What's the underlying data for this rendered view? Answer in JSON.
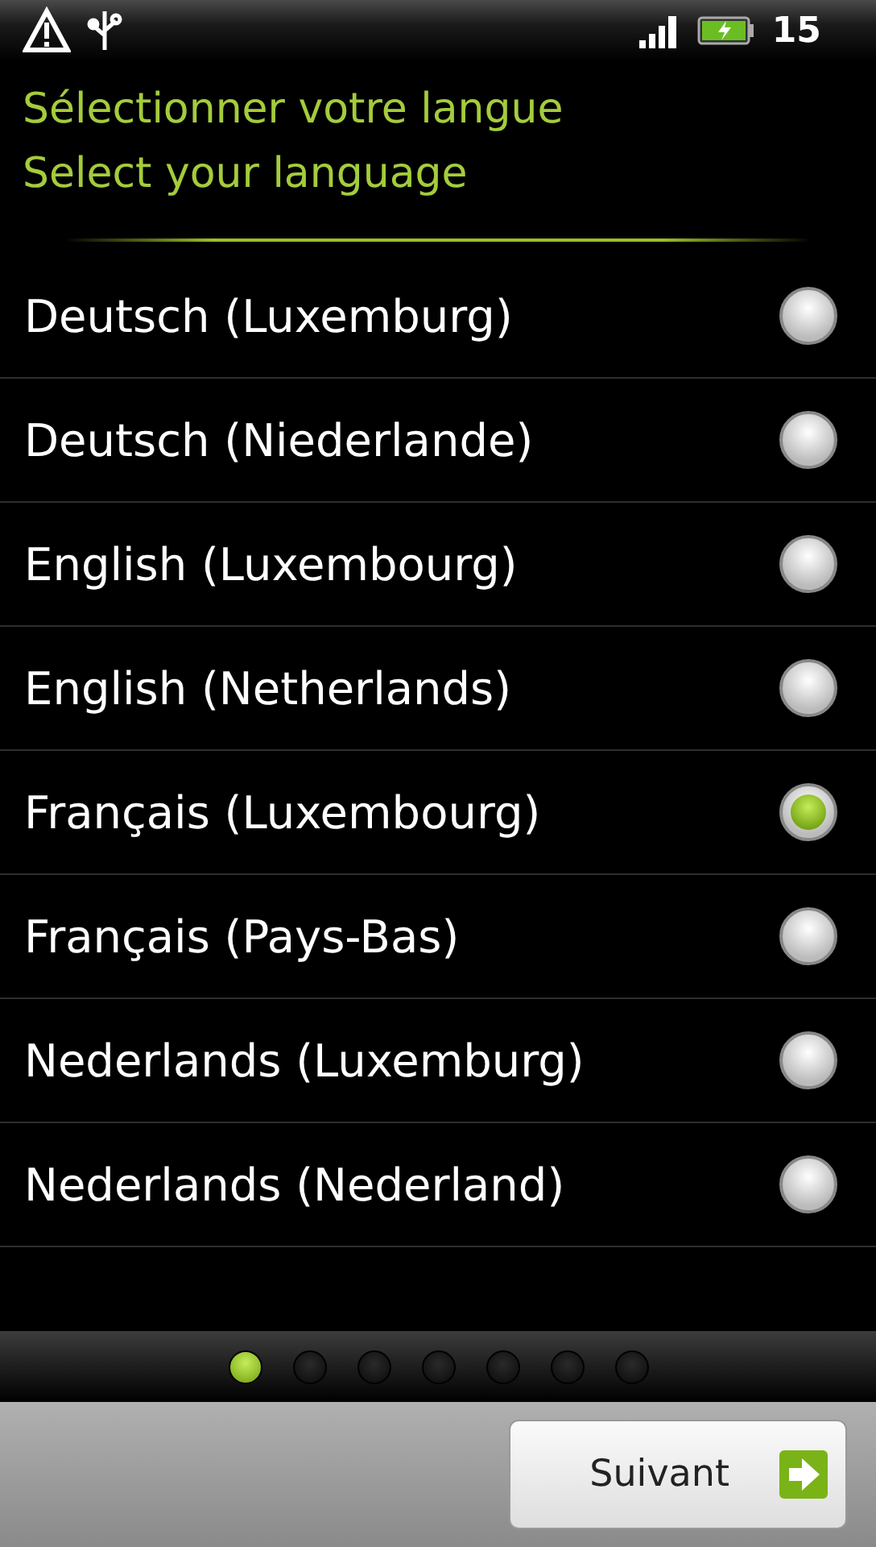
{
  "status_bar": {
    "time": "15"
  },
  "titles": [
    "Sélectionner votre langue",
    "Select your language"
  ],
  "languages": [
    {
      "label": "Deutsch (Luxemburg)",
      "selected": false
    },
    {
      "label": "Deutsch (Niederlande)",
      "selected": false
    },
    {
      "label": "English (Luxembourg)",
      "selected": false
    },
    {
      "label": "English (Netherlands)",
      "selected": false
    },
    {
      "label": "Français (Luxembourg)",
      "selected": true
    },
    {
      "label": "Français (Pays-Bas)",
      "selected": false
    },
    {
      "label": "Nederlands (Luxemburg)",
      "selected": false
    },
    {
      "label": "Nederlands (Nederland)",
      "selected": false
    }
  ],
  "pages": [
    {
      "selected": true
    },
    {
      "selected": false
    },
    {
      "selected": false
    },
    {
      "selected": false
    },
    {
      "selected": false
    },
    {
      "selected": false
    },
    {
      "selected": false
    }
  ],
  "next_button": {
    "label": "Suivant"
  }
}
